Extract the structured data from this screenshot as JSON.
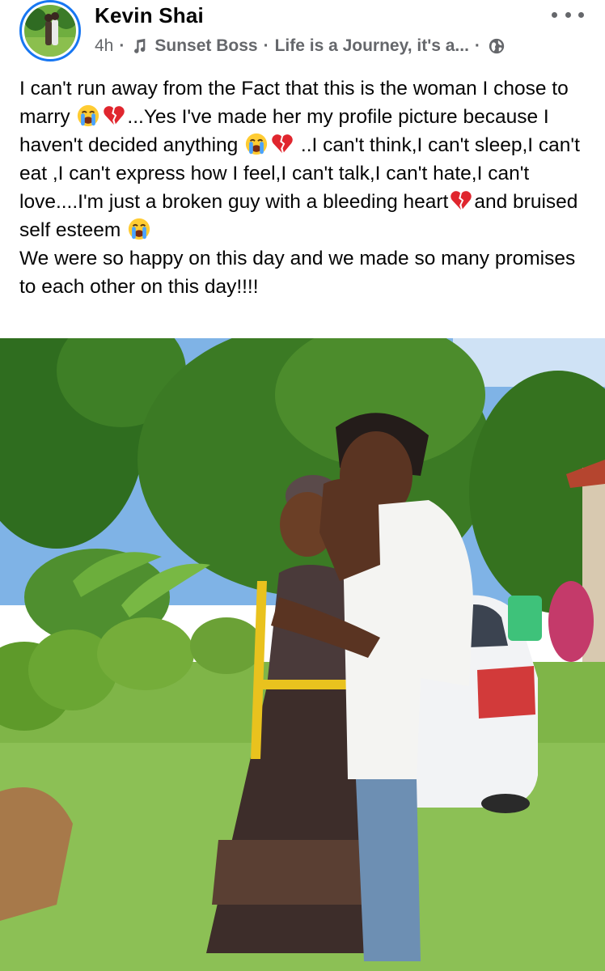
{
  "post": {
    "author": "Kevin Shai",
    "time": "4h",
    "song_artist": "Sunset Boss",
    "song_title": "Life is a Journey, it's a...",
    "text_segments": [
      "I can't run away from the Fact that this is the woman I chose to marry ",
      "...Yes I've made her my profile picture because I haven't decided anything ",
      " ..I can't think,I can't sleep,I can't eat ,I can't express how I feel,I can't talk,I can't hate,I can't love....I'm just a broken guy with a bleeding heart",
      "and bruised self esteem ",
      "\nWe were so happy on this day and we made so many promises to each other on this day!!!!"
    ]
  },
  "icons": {
    "more": "more-horizontal-icon",
    "music": "music-note-icon",
    "audience": "globe-icon",
    "emoji_crying": "loudly-crying-face-emoji",
    "emoji_broken_heart": "broken-heart-emoji"
  },
  "colors": {
    "text_primary": "#050505",
    "text_secondary": "#65676b",
    "avatar_ring": "#1877f2",
    "broken_heart": "#e0262e",
    "emoji_yellow": "#ffcc33",
    "emoji_tear": "#4aa3ff"
  }
}
